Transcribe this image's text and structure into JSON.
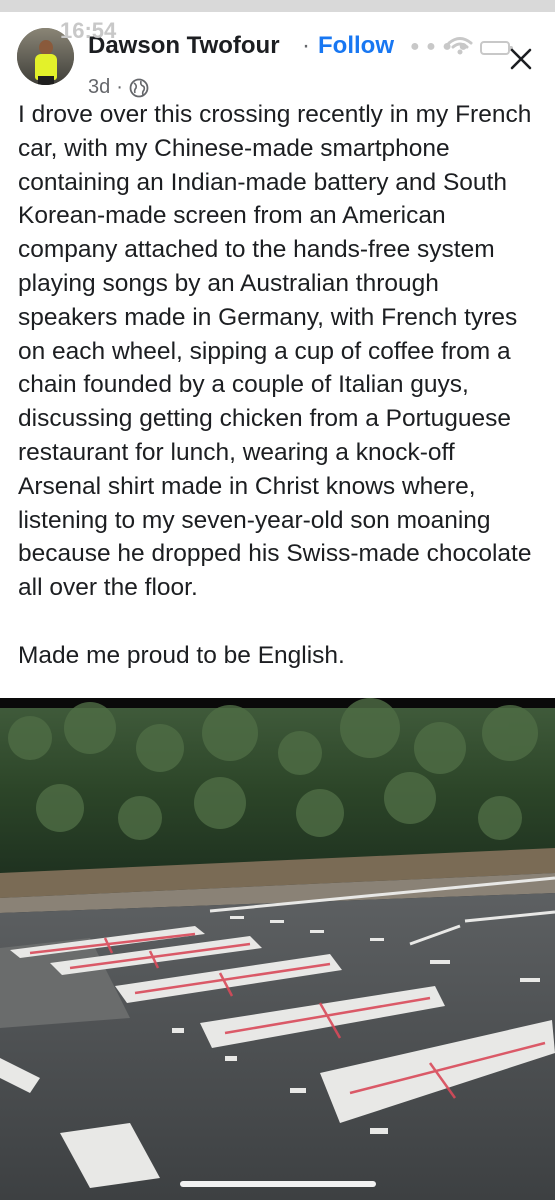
{
  "status_bar": {
    "time": "16:54"
  },
  "post": {
    "author": "Dawson Twofour",
    "separator": "·",
    "follow_label": "Follow",
    "age": "3d",
    "meta_separator": "·",
    "audience_icon": "globe-icon",
    "body_paragraph_1": "I drove over this crossing recently in my French car, with my Chinese-made smartphone containing an Indian-made battery and South Korean-made screen from an American company attached to the hands-free system playing songs by an Australian through speakers made in Germany, with French tyres on each wheel, sipping a cup of coffee from a chain founded by a couple of Italian guys, discussing getting chicken from a Portuguese restaurant for lunch, wearing a knock-off Arsenal shirt made in Christ knows where, listening to my seven-year-old son moaning because he dropped his Swiss-made chocolate all over the floor.",
    "body_paragraph_2": "Made me proud to be English."
  },
  "icons": {
    "close": "close-icon",
    "wifi": "wifi-icon",
    "battery": "battery-icon"
  },
  "colors": {
    "follow": "#1877f2",
    "text": "#1c1e21",
    "meta": "#65676b"
  }
}
